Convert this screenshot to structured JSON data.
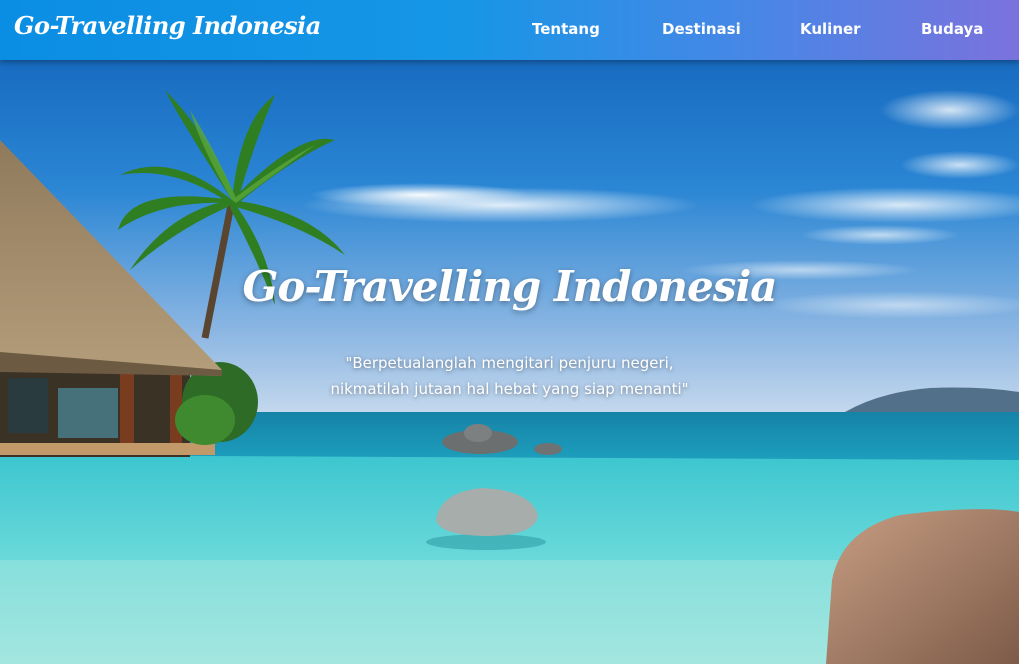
{
  "navbar": {
    "brand": "Go-Travelling Indonesia",
    "links": [
      "Tentang",
      "Destinasi",
      "Kuliner",
      "Budaya"
    ]
  },
  "hero": {
    "title": "Go-Travelling Indonesia",
    "tagline_line1": "\"Berpetualanglah mengitari penjuru negeri,",
    "tagline_line2": "nikmatilah jutaan hal hebat yang siap menanti\""
  },
  "colors": {
    "navbar_start": "#0a8ee3",
    "navbar_end": "#7b72dd",
    "sky": "#1f7fd0",
    "sea": "#1a9fb8",
    "pool": "#5fd6d8"
  },
  "icons": [
    "palm-tree-icon"
  ]
}
